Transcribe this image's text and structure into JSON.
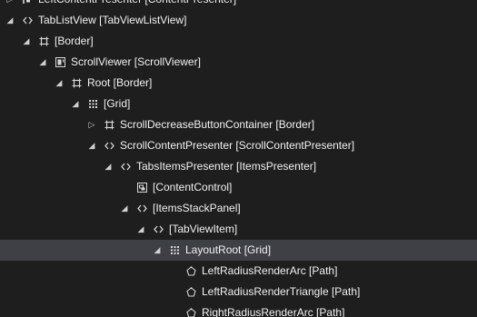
{
  "tree": {
    "rows": [
      {
        "label": "LeftContentPresenter [ContentPresenter]",
        "arrow": "collapsed",
        "icon": "content-presenter-icon",
        "depth": 1
      },
      {
        "label": "TabListView [TabViewListView]",
        "arrow": "expanded",
        "icon": "code-brackets-icon",
        "depth": 1
      },
      {
        "label": "[Border]",
        "arrow": "expanded",
        "icon": "border-frame-icon",
        "depth": 2
      },
      {
        "label": "ScrollViewer [ScrollViewer]",
        "arrow": "expanded",
        "icon": "scroll-viewer-icon",
        "depth": 3
      },
      {
        "label": "Root [Border]",
        "arrow": "expanded",
        "icon": "border-frame-icon",
        "depth": 4
      },
      {
        "label": "[Grid]",
        "arrow": "expanded",
        "icon": "grid-dots-icon",
        "depth": 5
      },
      {
        "label": "ScrollDecreaseButtonContainer [Border]",
        "arrow": "collapsed",
        "icon": "border-frame-icon",
        "depth": 6
      },
      {
        "label": "ScrollContentPresenter [ScrollContentPresenter]",
        "arrow": "expanded",
        "icon": "code-brackets-icon",
        "depth": 6
      },
      {
        "label": "TabsItemsPresenter [ItemsPresenter]",
        "arrow": "expanded",
        "icon": "code-brackets-icon",
        "depth": 7
      },
      {
        "label": "[ContentControl]",
        "arrow": "none",
        "icon": "content-control-icon",
        "depth": 8
      },
      {
        "label": "[ItemsStackPanel]",
        "arrow": "expanded",
        "icon": "code-brackets-icon",
        "depth": 8
      },
      {
        "label": "[TabViewItem]",
        "arrow": "expanded",
        "icon": "code-brackets-icon",
        "depth": 9
      },
      {
        "label": "LayoutRoot [Grid]",
        "arrow": "expanded",
        "icon": "grid-dots-icon",
        "depth": 10,
        "selected": true
      },
      {
        "label": "LeftRadiusRenderArc [Path]",
        "arrow": "none",
        "icon": "path-shape-icon",
        "depth": 11
      },
      {
        "label": "LeftRadiusRenderTriangle [Path]",
        "arrow": "none",
        "icon": "path-shape-icon",
        "depth": 11
      },
      {
        "label": "RightRadiusRenderArc [Path]",
        "arrow": "none",
        "icon": "path-shape-icon",
        "depth": 11
      }
    ]
  },
  "colors": {
    "background": "#1e1e1e",
    "selected_row": "#3f3f46",
    "text": "#f1f1f1",
    "arrow": "#d0d0d0",
    "icon": "#d8d8d8"
  }
}
